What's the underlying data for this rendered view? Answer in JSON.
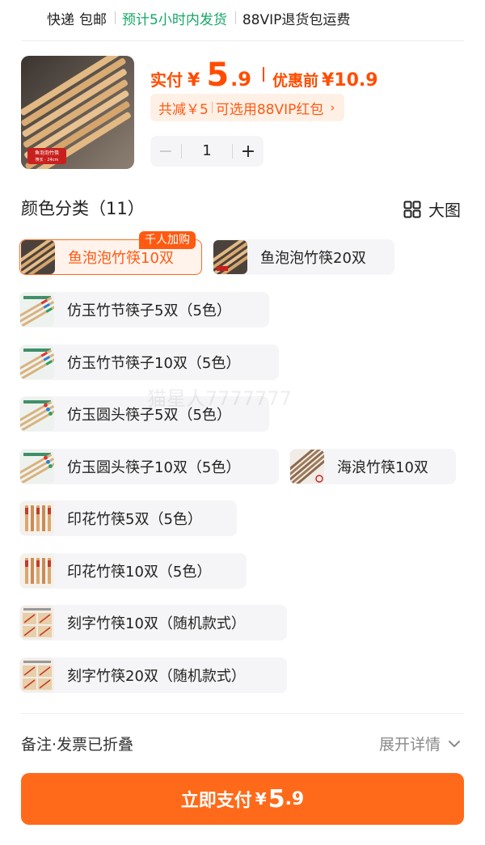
{
  "shipping": {
    "delivery": "快递",
    "free_shipping": "包邮",
    "estimate": "预计5小时内发货",
    "vip_return": "88VIP退货包运费"
  },
  "product": {
    "thumb_caption_1": "鱼泡泡竹筷",
    "thumb_caption_2": "筷长 · 24cm"
  },
  "price": {
    "actual_label": "实付",
    "currency": "¥",
    "actual_int": "5",
    "actual_dec": ".9",
    "original_label": "优惠前",
    "original_value": "¥10.9"
  },
  "promo": {
    "discount": "共减￥5",
    "coupon": "可选用88VIP红包",
    "chevron": "›"
  },
  "quantity": {
    "minus": "−",
    "value": "1",
    "plus": "+"
  },
  "section": {
    "title": "颜色分类（11）",
    "big_view": "大图"
  },
  "hot_badge": "千人加购",
  "variants": [
    {
      "label": "鱼泡泡竹筷10双",
      "selected": true,
      "thumb_icon": "bamboo-chopsticks-thumbnail"
    },
    {
      "label": "鱼泡泡竹筷20双",
      "selected": false,
      "thumb_icon": "bamboo-chopsticks-thumbnail"
    },
    {
      "label": "仿玉竹节筷子5双（5色）",
      "selected": false,
      "thumb_icon": "jade-chopsticks-thumbnail"
    },
    {
      "label": "仿玉竹节筷子10双（5色）",
      "selected": false,
      "thumb_icon": "jade-chopsticks-thumbnail"
    },
    {
      "label": "仿玉圆头筷子5双（5色）",
      "selected": false,
      "thumb_icon": "jade-chopsticks-thumbnail"
    },
    {
      "label": "仿玉圆头筷子10双（5色）",
      "selected": false,
      "thumb_icon": "jade-chopsticks-thumbnail"
    },
    {
      "label": "海浪竹筷10双",
      "selected": false,
      "thumb_icon": "wave-chopsticks-thumbnail"
    },
    {
      "label": "印花竹筷5双（5色）",
      "selected": false,
      "thumb_icon": "printed-chopsticks-thumbnail"
    },
    {
      "label": "印花竹筷10双（5色）",
      "selected": false,
      "thumb_icon": "printed-chopsticks-thumbnail"
    },
    {
      "label": "刻字竹筷10双（随机款式）",
      "selected": false,
      "thumb_icon": "engraved-chopsticks-thumbnail"
    },
    {
      "label": "刻字竹筷20双（随机款式）",
      "selected": false,
      "thumb_icon": "engraved-chopsticks-thumbnail"
    }
  ],
  "watermark": "猫星人7777777",
  "remarks": {
    "label": "备注·发票已折叠",
    "expand": "展开详情"
  },
  "pay": {
    "label": "立即支付",
    "currency": "¥",
    "int": "5",
    "dec": ".9"
  },
  "colors": {
    "accent": "#ff6a1a",
    "price": "#ff4d00",
    "green": "#14a765",
    "chip_bg": "#f5f5f7",
    "promo_bg": "#fff0e6"
  }
}
